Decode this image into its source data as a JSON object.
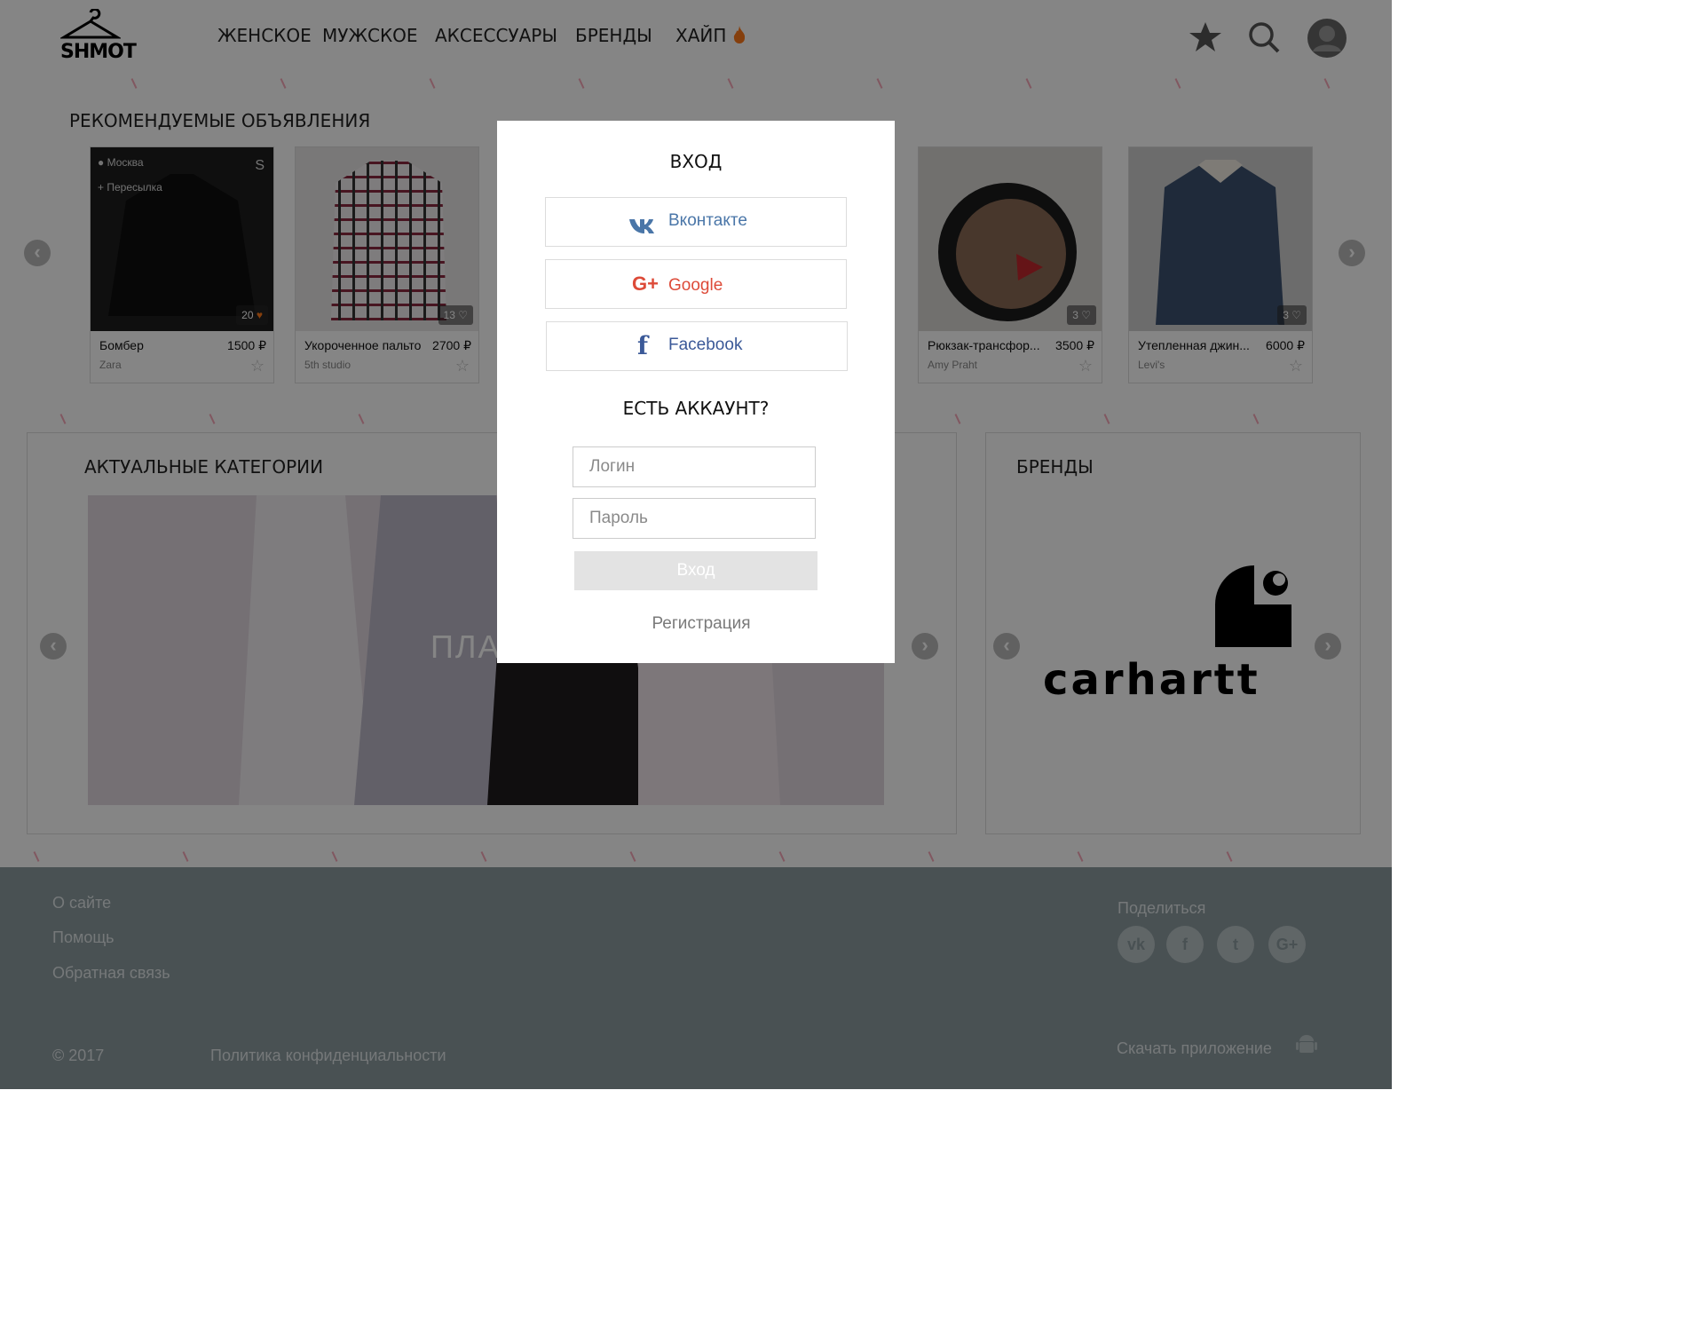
{
  "header": {
    "logo_text": "SHMOT",
    "nav": [
      "ЖЕНСКОЕ",
      "МУЖСКОЕ",
      "АКСЕССУАРЫ",
      "БРЕНДЫ",
      "ХАЙП"
    ],
    "icons": [
      "hanger-logo-icon",
      "fire-icon",
      "star-icon",
      "search-icon",
      "user-avatar-icon"
    ]
  },
  "recommended": {
    "title": "РЕКОМЕНДУЕМЫЕ ОБЪЯВЛЕНИЯ",
    "cards": [
      {
        "name": "Бомбер",
        "price": "1500 ₽",
        "brand": "Zara",
        "likes": "20",
        "city": "Москва",
        "shipping": "Пересылка",
        "size": "S"
      },
      {
        "name": "Укороченное пальто",
        "price": "2700 ₽",
        "brand": "5th studio",
        "likes": "13"
      },
      {
        "name": "Рюкзак-трансфор...",
        "price": "3500 ₽",
        "brand": "Amy Praht",
        "likes": "3"
      },
      {
        "name": "Утепленная джин...",
        "price": "6000 ₽",
        "brand": "Levi's",
        "likes": "3"
      }
    ]
  },
  "categories": {
    "title": "АКТУАЛЬНЫЕ КАТЕГОРИИ",
    "banner_text": "ПЛА"
  },
  "brands": {
    "title": "БРЕНДЫ",
    "logo_text": "carhartt"
  },
  "footer": {
    "links": [
      "О сайте",
      "Помощь",
      "Обратная связь"
    ],
    "copyright": "© 2017",
    "privacy": "Политика конфиденциальности",
    "share_label": "Поделиться",
    "download": "Скачать приложение",
    "social": [
      "vk-icon",
      "facebook-icon",
      "twitter-icon",
      "google-plus-icon"
    ]
  },
  "modal": {
    "title": "ВХОД",
    "vk": "Вконтакте",
    "google": "Google",
    "facebook": "Facebook",
    "have_account": "ЕСТЬ АККАУНТ?",
    "login_placeholder": "Логин",
    "password_placeholder": "Пароль",
    "submit": "Вход",
    "register": "Регистрация",
    "colors": {
      "vk": "#4a76a8",
      "google": "#dd4b39",
      "facebook": "#3b5998"
    }
  }
}
